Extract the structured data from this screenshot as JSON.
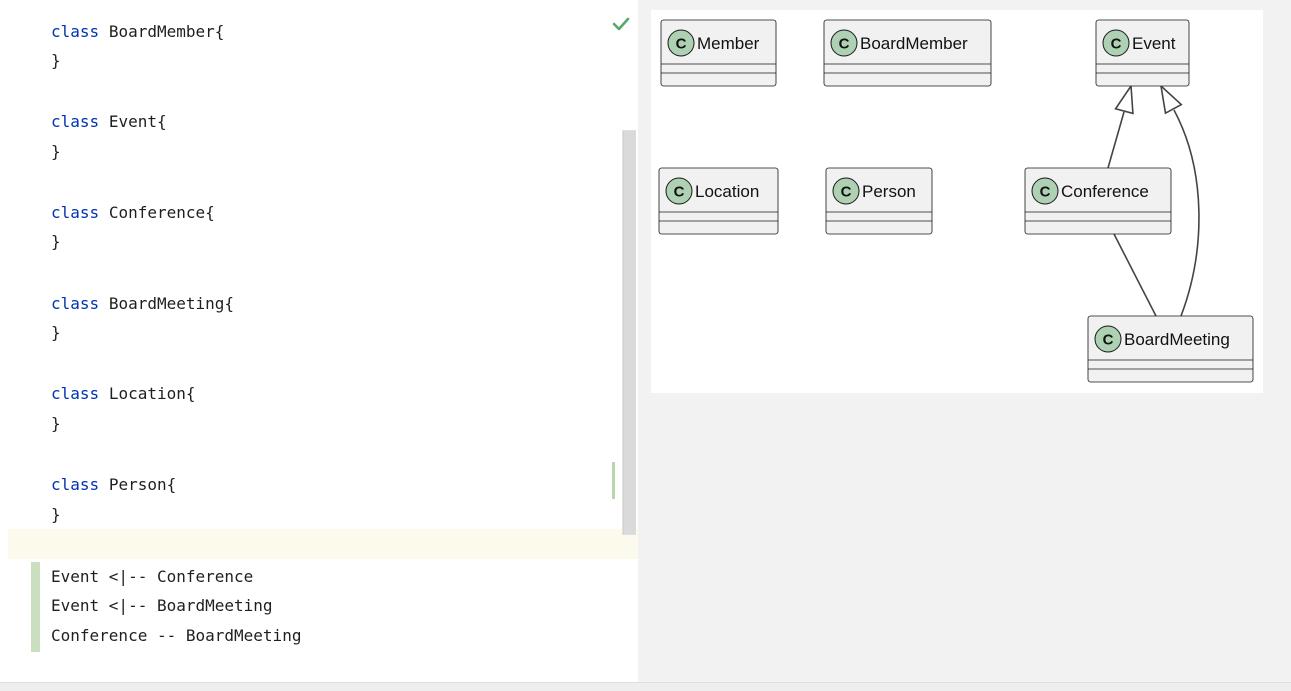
{
  "editor": {
    "lines": [
      {
        "keyword": "class",
        "name": "BoardMember{"
      },
      {
        "text": "}"
      },
      {
        "keyword": "class",
        "name": "Event{"
      },
      {
        "text": "}"
      },
      {
        "keyword": "class",
        "name": "Conference{"
      },
      {
        "text": "}"
      },
      {
        "keyword": "class",
        "name": "BoardMeeting{"
      },
      {
        "text": "}"
      },
      {
        "keyword": "class",
        "name": "Location{"
      },
      {
        "text": "}"
      },
      {
        "keyword": "class",
        "name": "Person{"
      },
      {
        "text": "}"
      }
    ],
    "relations": [
      "Event <|-- Conference",
      "Event <|-- BoardMeeting",
      "Conference -- BoardMeeting"
    ],
    "status_icon": "check-icon",
    "status_color": "#59a869"
  },
  "diagram": {
    "stereotype": "C",
    "colors": {
      "class_fill": "#f1f1f1",
      "class_border": "#181818",
      "badge": "#add1b2",
      "line": "#444444"
    },
    "classes": [
      {
        "id": "member",
        "name": "Member"
      },
      {
        "id": "boardmember",
        "name": "BoardMember"
      },
      {
        "id": "event",
        "name": "Event"
      },
      {
        "id": "location",
        "name": "Location"
      },
      {
        "id": "person",
        "name": "Person"
      },
      {
        "id": "conference",
        "name": "Conference"
      },
      {
        "id": "boardmeeting",
        "name": "BoardMeeting"
      }
    ],
    "edges": [
      {
        "from": "conference",
        "to": "event",
        "type": "inheritance"
      },
      {
        "from": "boardmeeting",
        "to": "event",
        "type": "inheritance"
      },
      {
        "from": "conference",
        "to": "boardmeeting",
        "type": "association"
      }
    ]
  }
}
